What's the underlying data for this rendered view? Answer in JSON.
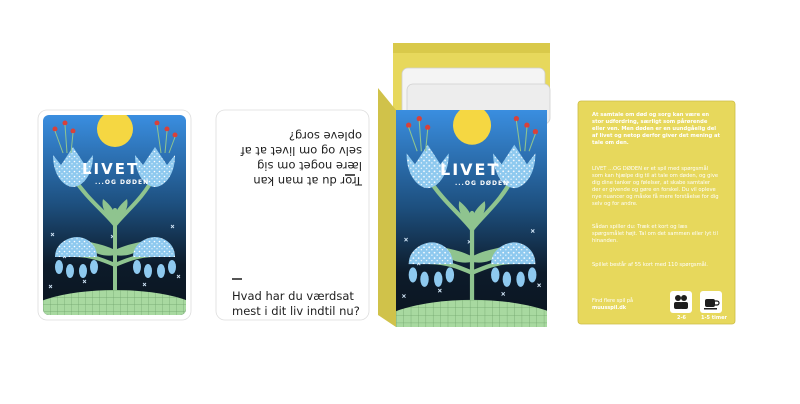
{
  "front_card": {
    "title": "LIVET",
    "subtitle": "...OG DØDEN"
  },
  "question_card": {
    "top_question": "Tror du at man kan lære noget om sig selv og om livet at af opleve sorg?",
    "bottom_question": "Hvad har du værdsat mest i dit liv indtil nu?"
  },
  "box_front": {
    "title": "LIVET",
    "subtitle": "...OG DØDEN"
  },
  "box_back": {
    "intro": "At samtale om død og sorg kan være en stor udfordring, særligt som pårørende eller ven. Men døden er en uundgåelig del af livet og netop derfor giver det mening at tale om den.",
    "body": "LIVET ...OG DØDEN er et spil med spørgsmål som kan hjælpe dig til at tale om døden, og give dig dine tanker og følelser, at skabe samtaler der er givende og gøre en forskel. Du vil opleve nye nuancer og måske få mere forståelse for dig selv og for andre.",
    "how_to": "Sådan spiller du: Træk et kort og læs spørgsmålet højt. Tal om det sammen eller lyt til hinanden.",
    "extra": "Spillet består af 55 kort med 110 spørgsmål.",
    "footer": "Find flere spil på",
    "website": "muusspil.dk",
    "players": "2-6",
    "duration": "1-5 timer"
  },
  "colors": {
    "sky_top": "#3a8ee0",
    "sky_bottom": "#0d1b2a",
    "sun": "#f5d742",
    "petal": "#8ec9ef",
    "leaf": "#8fc48f",
    "ground": "#a8d9a0",
    "box_yellow": "#e7d85c",
    "berry": "#d8413a"
  }
}
